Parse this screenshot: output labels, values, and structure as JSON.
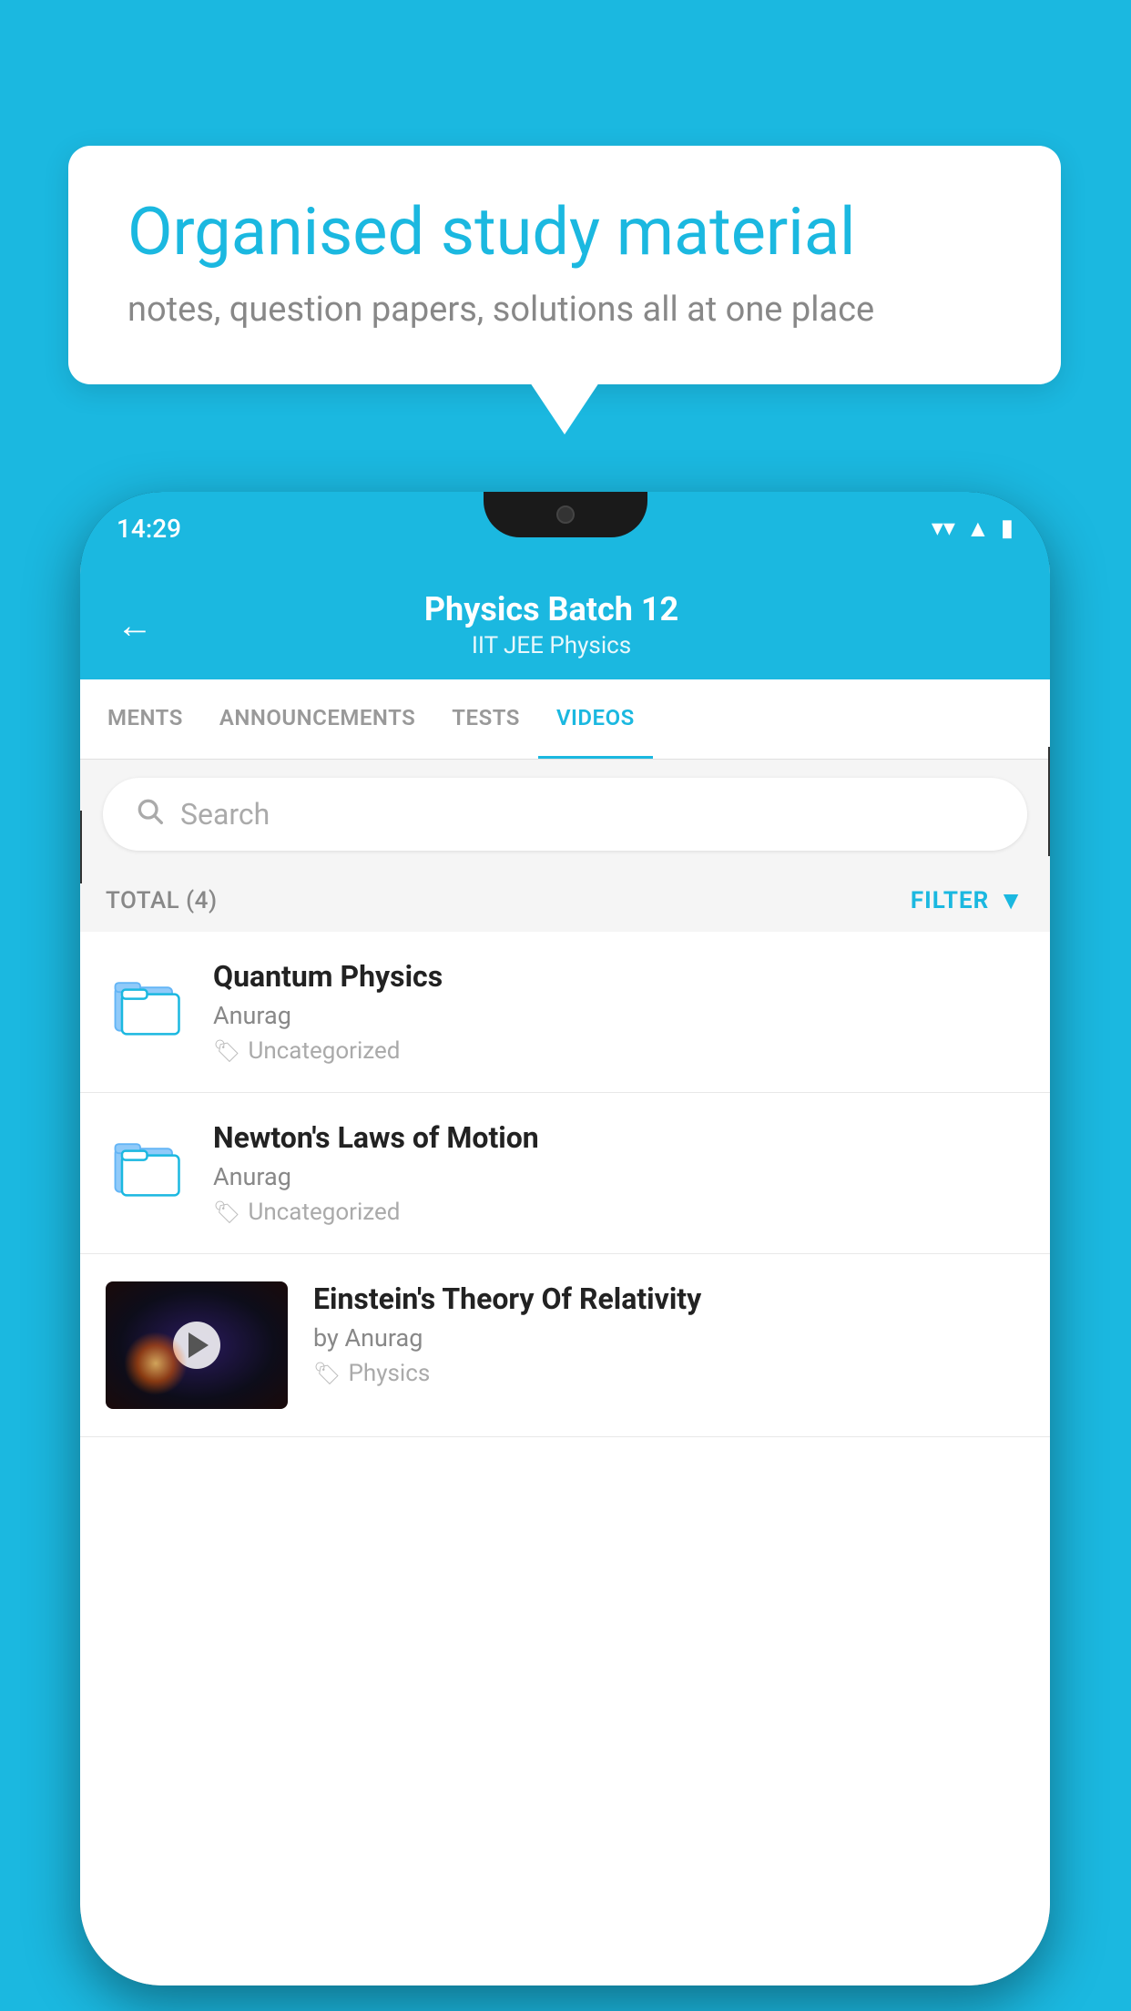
{
  "background": {
    "color": "#1BB8E0"
  },
  "speech_bubble": {
    "title": "Organised study material",
    "subtitle": "notes, question papers, solutions all at one place"
  },
  "phone": {
    "status_bar": {
      "time": "14:29"
    },
    "header": {
      "title": "Physics Batch 12",
      "subtitle": "IIT JEE   Physics",
      "back_label": "←"
    },
    "tabs": [
      {
        "label": "MENTS",
        "active": false
      },
      {
        "label": "ANNOUNCEMENTS",
        "active": false
      },
      {
        "label": "TESTS",
        "active": false
      },
      {
        "label": "VIDEOS",
        "active": true
      }
    ],
    "search": {
      "placeholder": "Search"
    },
    "filter_bar": {
      "total_label": "TOTAL (4)",
      "filter_label": "FILTER"
    },
    "items": [
      {
        "type": "folder",
        "title": "Quantum Physics",
        "author": "Anurag",
        "tag": "Uncategorized"
      },
      {
        "type": "folder",
        "title": "Newton's Laws of Motion",
        "author": "Anurag",
        "tag": "Uncategorized"
      },
      {
        "type": "video",
        "title": "Einstein's Theory Of Relativity",
        "author": "by Anurag",
        "tag": "Physics"
      }
    ]
  }
}
